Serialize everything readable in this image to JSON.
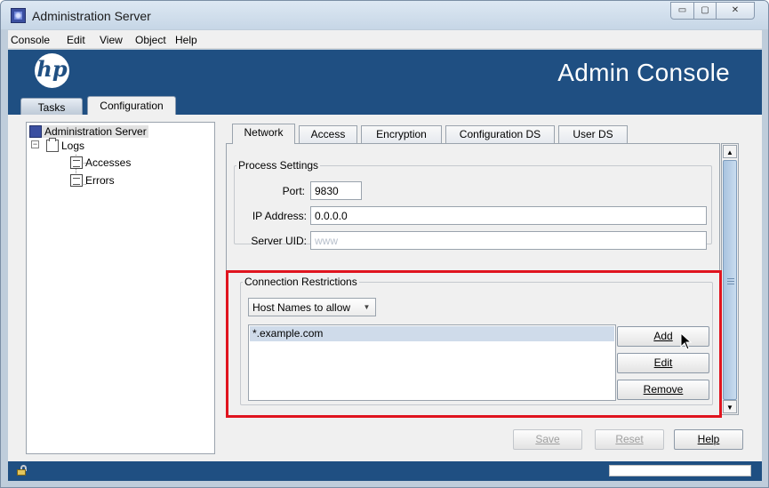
{
  "window": {
    "title": "Administration Server",
    "controls": {
      "minimize": "▭",
      "maximize": "▢",
      "close": "✕"
    }
  },
  "menubar": {
    "items": [
      "Console",
      "Edit",
      "View",
      "Object",
      "Help"
    ]
  },
  "banner": {
    "logo_text": "hp",
    "title": "Admin Console",
    "tabs": {
      "tasks": "Tasks",
      "configuration": "Configuration"
    }
  },
  "tree": {
    "root": "Administration Server",
    "expander": "⊟",
    "logs": "Logs",
    "children": [
      "Accesses",
      "Errors"
    ]
  },
  "tabs": [
    "Network",
    "Access",
    "Encryption",
    "Configuration DS",
    "User DS"
  ],
  "active_tab": "Network",
  "process_settings": {
    "legend": "Process Settings",
    "port_label": "Port:",
    "port_value": "9830",
    "ip_label": "IP Address:",
    "ip_value": "0.0.0.0",
    "uid_label": "Server UID:",
    "uid_value": "www"
  },
  "connection_restrictions": {
    "legend": "Connection Restrictions",
    "select_value": "Host Names to allow",
    "list_items": [
      "*.example.com"
    ],
    "buttons": {
      "add": "Add",
      "edit": "Edit",
      "remove": "Remove"
    }
  },
  "footer_buttons": {
    "save": "Save",
    "reset": "Reset",
    "help": "Help"
  },
  "icons": {
    "app": "server-icon",
    "lock": "lock-icon",
    "folder": "folder-icon",
    "doc": "document-icon",
    "scroll_up": "▲",
    "scroll_down": "▼",
    "chevron": "▼"
  },
  "colors": {
    "banner": "#1f4f82",
    "highlight": "#e0141e",
    "selection": "#cfdbea"
  }
}
